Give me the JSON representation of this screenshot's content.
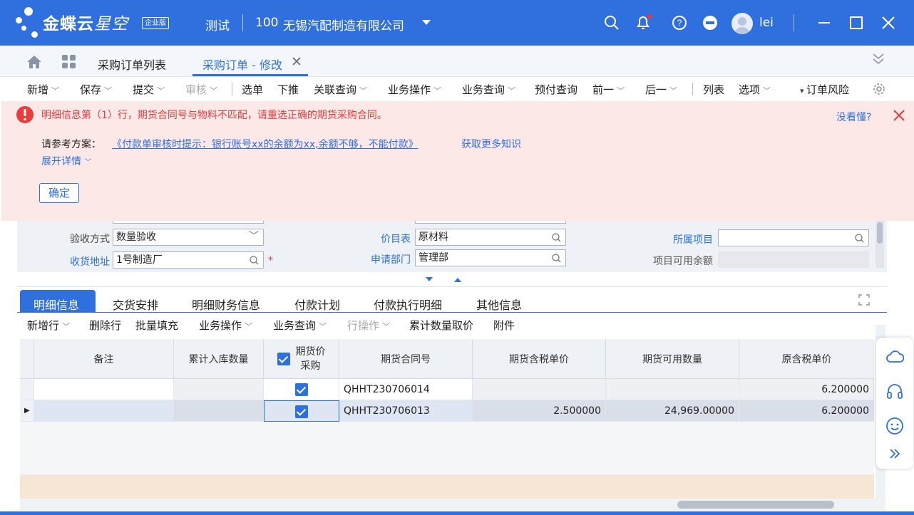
{
  "topbar": {
    "brand_main": "金蝶云",
    "brand_sub": "星空",
    "edition": "企业版",
    "env": "测试",
    "org_code": "100",
    "org_name": "无锡汽配制造有限公司",
    "user": "lei",
    "accent": "#2f6fde"
  },
  "tabs": {
    "list": "采购订单列表",
    "active": "采购订单 - 修改"
  },
  "toolbar": {
    "items": [
      "新增",
      "保存",
      "提交",
      "审核",
      "选单",
      "下推",
      "关联查询",
      "业务操作",
      "业务查询",
      "预付查询",
      "前一",
      "后一",
      "列表",
      "选项",
      "订单风险"
    ]
  },
  "error": {
    "message": "明细信息第（1）行，期货合同号与物料不匹配，请重选正确的期货采购合同。",
    "help": "没看懂?",
    "ref_label": "请参考方案：",
    "ref_link": "《付款单审核时提示：银行账号xx的余额为xx,余额不够，不能付款》",
    "more": "获取更多知识",
    "expand": "展开详情",
    "ok": "确定",
    "color": "#e83d3d"
  },
  "form": {
    "acceptance_label": "验收方式",
    "acceptance_value": "数量验收",
    "address_label": "收货地址",
    "address_value": "1号制造厂",
    "pricelist_label": "价目表",
    "pricelist_value": "原材料",
    "dept_label": "申请部门",
    "dept_value": "管理部",
    "project_label": "所属项目",
    "project_balance_label": "项目可用余额"
  },
  "detail_tabs": [
    "明细信息",
    "交货安排",
    "明细财务信息",
    "付款计划",
    "付款执行明细",
    "其他信息"
  ],
  "detail_toolbar": [
    "新增行",
    "删除行",
    "批量填充",
    "业务操作",
    "业务查询",
    "行操作",
    "累计数量取价",
    "附件"
  ],
  "grid": {
    "headers": [
      "备注",
      "累计入库数量",
      "期货价采购",
      "期货合同号",
      "期货含税单价",
      "期货可用数量",
      "原含税单价"
    ],
    "rows": [
      {
        "contract": "QHHT230706014",
        "price": "",
        "qty": "",
        "orig": "6.200000"
      },
      {
        "contract": "QHHT230706013",
        "price": "2.500000",
        "qty": "24,969.00000",
        "orig": "6.200000"
      }
    ]
  }
}
